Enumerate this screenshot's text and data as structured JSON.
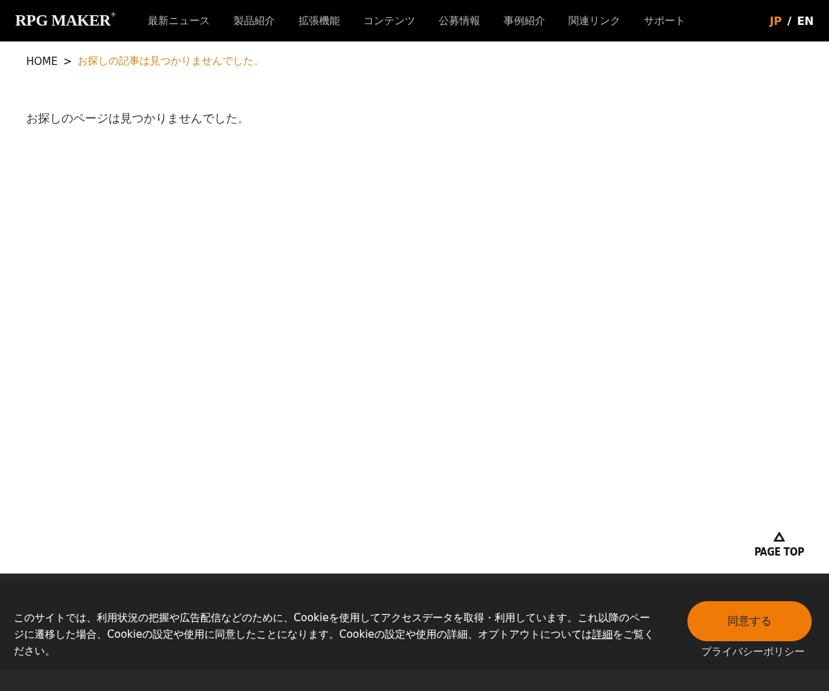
{
  "header": {
    "logo": "RPG MAKER",
    "logo_mark": "®",
    "nav": [
      {
        "label": "最新ニュース"
      },
      {
        "label": "製品紹介"
      },
      {
        "label": "拡張機能"
      },
      {
        "label": "コンテンツ"
      },
      {
        "label": "公募情報"
      },
      {
        "label": "事例紹介"
      },
      {
        "label": "関連リンク"
      },
      {
        "label": "サポート"
      }
    ],
    "languages": [
      {
        "label": "JP",
        "selected": true
      },
      {
        "label": "EN",
        "selected": false
      }
    ],
    "language_separator": "/"
  },
  "breadcrumb": {
    "items": [
      {
        "label": "HOME",
        "current": false
      },
      {
        "label": "お探しの記事は見つかりませんでした。",
        "current": true
      }
    ],
    "separator": ">"
  },
  "message": "お探しのページは見つかりませんでした。",
  "page_top": {
    "label": "PAGE TOP"
  },
  "cookie_banner": {
    "text_before": "このサイトでは、利用状況の把握や広告配信などのために、Cookieを使用してアクセスデータを取得・利用しています。これ以降のページに遷移した場合、Cookieの設定や使用に同意したことになります。Cookieの設定や使用の詳細、オプトアウトについては",
    "link": "詳細",
    "text_after": "をご覧ください。",
    "accept_button": "同意する",
    "policy_link": "プライバシーポリシー"
  }
}
